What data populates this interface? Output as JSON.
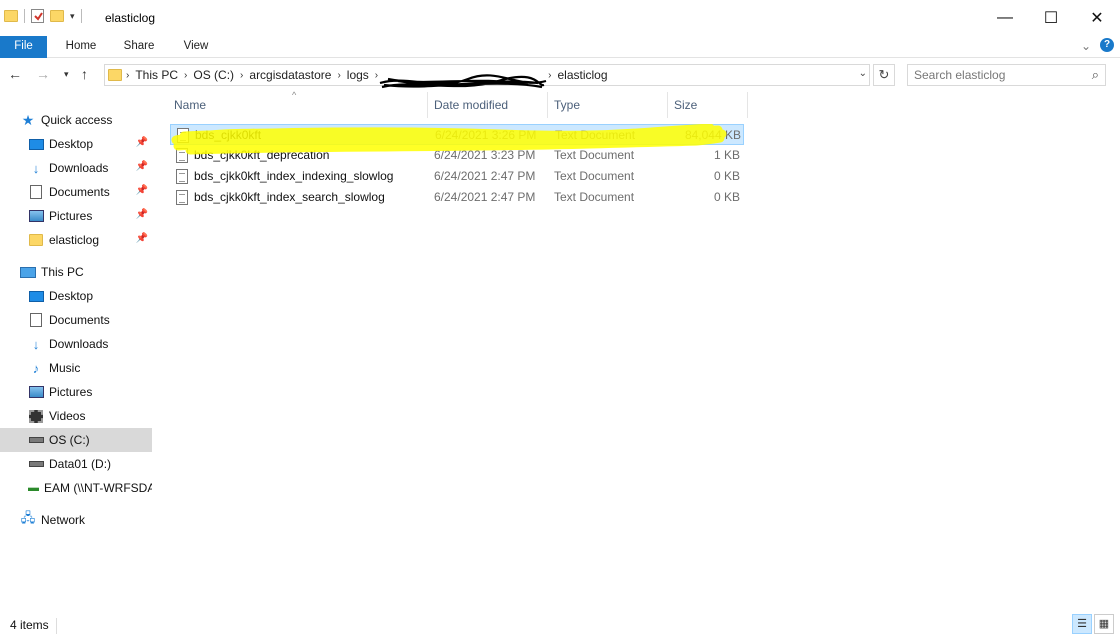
{
  "window": {
    "title": "elasticlog",
    "minimize_glyph": "—",
    "maximize_glyph": "☐",
    "close_glyph": "✕"
  },
  "ribbon": {
    "tabs": [
      "File",
      "Home",
      "Share",
      "View"
    ],
    "help_glyph": "?",
    "expand_glyph": "⌄"
  },
  "address": {
    "crumbs": [
      "This PC",
      "OS (C:)",
      "arcgisdatastore",
      "logs",
      "",
      "elasticlog"
    ],
    "refresh_glyph": "↻"
  },
  "search": {
    "placeholder": "Search elasticlog"
  },
  "nav": {
    "quick_access": {
      "label": "Quick access",
      "items": [
        "Desktop",
        "Downloads",
        "Documents",
        "Pictures",
        "elasticlog"
      ]
    },
    "this_pc": {
      "label": "This PC",
      "items": [
        "Desktop",
        "Documents",
        "Downloads",
        "Music",
        "Pictures",
        "Videos",
        "OS (C:)",
        "Data01 (D:)",
        "EAM (\\\\NT-WRFSDA"
      ]
    },
    "network": {
      "label": "Network"
    },
    "selected": "OS (C:)"
  },
  "columns": {
    "name": "Name",
    "date": "Date modified",
    "type": "Type",
    "size": "Size"
  },
  "files": [
    {
      "name": "bds_cjkk0kft",
      "date": "6/24/2021 3:26 PM",
      "type": "Text Document",
      "size": "84,044 KB",
      "selected": true
    },
    {
      "name": "bds_cjkk0kft_deprecation",
      "date": "6/24/2021 3:23 PM",
      "type": "Text Document",
      "size": "1 KB",
      "selected": false
    },
    {
      "name": "bds_cjkk0kft_index_indexing_slowlog",
      "date": "6/24/2021 2:47 PM",
      "type": "Text Document",
      "size": "0 KB",
      "selected": false
    },
    {
      "name": "bds_cjkk0kft_index_search_slowlog",
      "date": "6/24/2021 2:47 PM",
      "type": "Text Document",
      "size": "0 KB",
      "selected": false
    }
  ],
  "status": {
    "item_count": "4 items"
  },
  "colors": {
    "accent": "#1979ca",
    "selection": "#cce8ff",
    "highlighter": "#ffff00"
  }
}
